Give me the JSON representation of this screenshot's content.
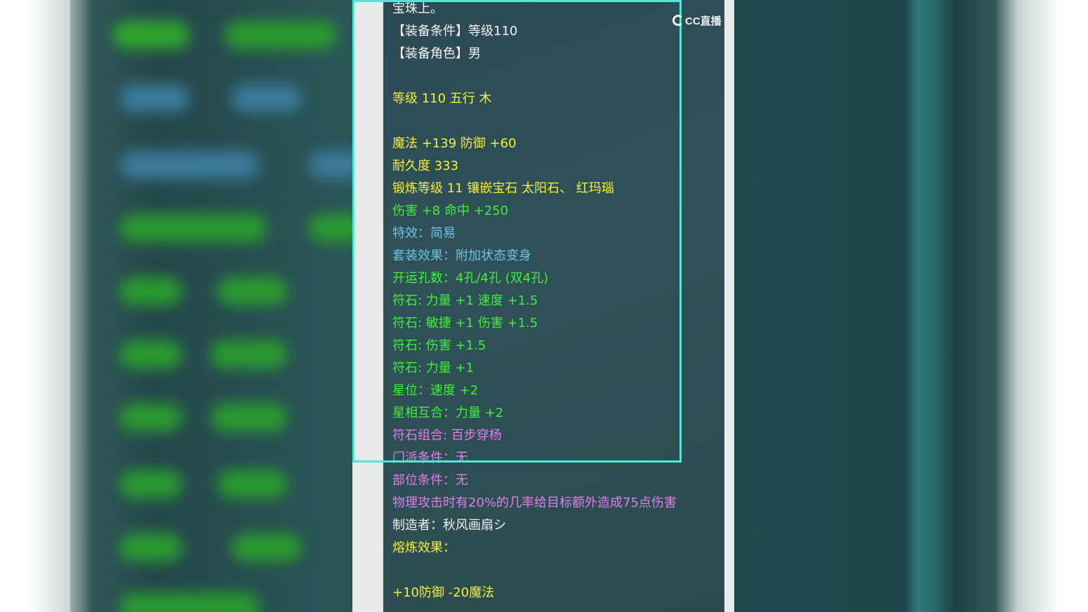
{
  "logo": {
    "text": "CC直播",
    "icon": "cc-logo-icon"
  },
  "item_lines": [
    {
      "text": "宝珠上。",
      "color": "white"
    },
    {
      "text": "【装备条件】等级110",
      "color": "white"
    },
    {
      "text": "【装备角色】男",
      "color": "white"
    },
    {
      "text": "",
      "color": "white"
    },
    {
      "text": "等级 110 五行 木",
      "color": "yellow"
    },
    {
      "text": "",
      "color": "white"
    },
    {
      "text": "魔法 +139 防御 +60",
      "color": "yellow"
    },
    {
      "text": "耐久度 333",
      "color": "yellow"
    },
    {
      "text": "锻炼等级 11 镶嵌宝石 太阳石、 红玛瑙",
      "color": "yellow"
    },
    {
      "text": "伤害 +8 命中 +250",
      "color": "green"
    },
    {
      "text": "特效：简易",
      "color": "blue"
    },
    {
      "text": "套装效果：附加状态变身",
      "color": "blue"
    },
    {
      "text": "开运孔数：4孔/4孔 (双4孔)",
      "color": "green"
    },
    {
      "text": "符石: 力量 +1 速度 +1.5",
      "color": "green"
    },
    {
      "text": "符石: 敏捷 +1 伤害 +1.5",
      "color": "green"
    },
    {
      "text": "符石: 伤害 +1.5",
      "color": "green"
    },
    {
      "text": "符石: 力量 +1",
      "color": "green"
    },
    {
      "text": "星位：速度 +2",
      "color": "green"
    },
    {
      "text": "星相互合：力量 +2",
      "color": "green"
    },
    {
      "text": "符石组合: 百步穿杨",
      "color": "pink"
    },
    {
      "text": "门派条件：无",
      "color": "pink"
    },
    {
      "text": "部位条件：无",
      "color": "pink"
    },
    {
      "text": "物理攻击时有20%的几率给目标额外造成75点伤害",
      "color": "pink"
    },
    {
      "text": "制造者：秋风画扇シ",
      "color": "white"
    },
    {
      "text": "熔炼效果：",
      "color": "yellow"
    },
    {
      "text": "",
      "color": "white"
    },
    {
      "text": "+10防御 -20魔法",
      "color": "yellow"
    }
  ],
  "colors": {
    "white": "#f2f2f2",
    "yellow": "#f4f03a",
    "green": "#3ef03a",
    "blue": "#6ec3e6",
    "pink": "#e07ee6",
    "highlight_border": "#4fe8d6"
  }
}
